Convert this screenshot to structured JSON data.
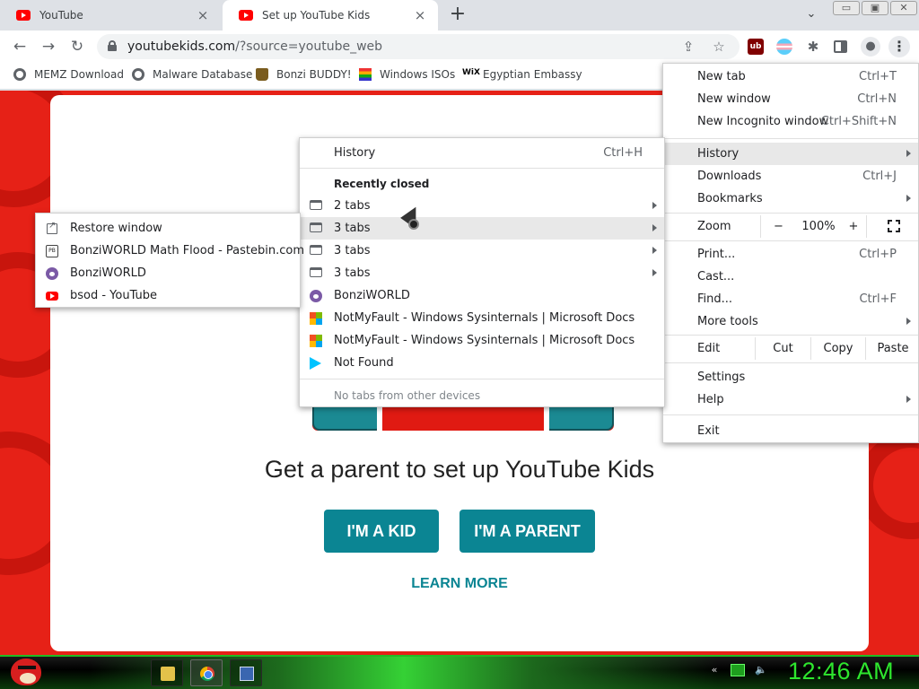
{
  "tabs": [
    {
      "title": "YouTube",
      "active": false
    },
    {
      "title": "Set up YouTube Kids",
      "active": true
    }
  ],
  "icons": {
    "tab_close": "×",
    "new_tab": "+",
    "tab_search": "⌄",
    "back": "←",
    "forward": "→",
    "reload": "↻",
    "share": "⇪",
    "star": "☆",
    "puzzle": "✱",
    "avatar": "●",
    "menu": "⋮",
    "minimize": "▭",
    "maximize": "▣",
    "close": "✕",
    "volume": "🔈"
  },
  "address": {
    "host": "youtubekids.com",
    "path": "/?source=youtube_web"
  },
  "extensions": {
    "ublock": "ub"
  },
  "bookmarks": [
    {
      "label": "MEMZ Download",
      "icon": "globe"
    },
    {
      "label": "Malware Database",
      "icon": "globe"
    },
    {
      "label": "Bonzi BUDDY!",
      "icon": "bonzi"
    },
    {
      "label": "Windows ISOs",
      "icon": "windows"
    },
    {
      "label": "Egyptian Embassy",
      "icon": "wix",
      "icon_text": "WiX"
    }
  ],
  "page": {
    "headline": "Get a parent to set up YouTube Kids",
    "kid_button": "I'M A KID",
    "parent_button": "I'M A PARENT",
    "learn_more": "LEARN MORE",
    "accent_color": "#0b8593",
    "background_color": "#e62117"
  },
  "chrome_menu": {
    "new_tab": {
      "label": "New tab",
      "shortcut": "Ctrl+T"
    },
    "new_window": {
      "label": "New window",
      "shortcut": "Ctrl+N"
    },
    "new_incognito": {
      "label": "New Incognito window",
      "shortcut": "Ctrl+Shift+N"
    },
    "history": {
      "label": "History"
    },
    "downloads": {
      "label": "Downloads",
      "shortcut": "Ctrl+J"
    },
    "bookmarks": {
      "label": "Bookmarks"
    },
    "zoom": {
      "label": "Zoom",
      "minus": "−",
      "value": "100%",
      "plus": "+"
    },
    "print": {
      "label": "Print...",
      "shortcut": "Ctrl+P"
    },
    "cast": {
      "label": "Cast..."
    },
    "find": {
      "label": "Find...",
      "shortcut": "Ctrl+F"
    },
    "more_tools": {
      "label": "More tools"
    },
    "edit": {
      "label": "Edit",
      "cut": "Cut",
      "copy": "Copy",
      "paste": "Paste"
    },
    "settings": {
      "label": "Settings"
    },
    "help": {
      "label": "Help"
    },
    "exit": {
      "label": "Exit"
    }
  },
  "history_menu": {
    "history": {
      "label": "History",
      "shortcut": "Ctrl+H"
    },
    "recently_closed": "Recently closed",
    "items": [
      {
        "label": "2 tabs",
        "icon": "tab",
        "submenu": true
      },
      {
        "label": "3 tabs",
        "icon": "tab",
        "submenu": true,
        "highlighted": true
      },
      {
        "label": "3 tabs",
        "icon": "tab",
        "submenu": true
      },
      {
        "label": "3 tabs",
        "icon": "tab",
        "submenu": true
      },
      {
        "label": "BonziWORLD",
        "icon": "bonzi"
      },
      {
        "label": "NotMyFault - Windows Sysinternals | Microsoft Docs",
        "icon": "microsoft"
      },
      {
        "label": "NotMyFault - Windows Sysinternals | Microsoft Docs",
        "icon": "microsoft"
      },
      {
        "label": "Not Found",
        "icon": "play-store"
      }
    ],
    "other_devices": "No tabs from other devices"
  },
  "tabs_submenu": {
    "items": [
      {
        "label": "Restore window",
        "icon": "restore"
      },
      {
        "label": "BonziWORLD Math Flood - Pastebin.com",
        "icon": "pastebin",
        "icon_text": "PB"
      },
      {
        "label": "BonziWORLD",
        "icon": "bonzi"
      },
      {
        "label": "bsod - YouTube",
        "icon": "youtube"
      }
    ]
  },
  "taskbar": {
    "clock": "12:46 AM",
    "clock_color": "#2ee62e"
  }
}
